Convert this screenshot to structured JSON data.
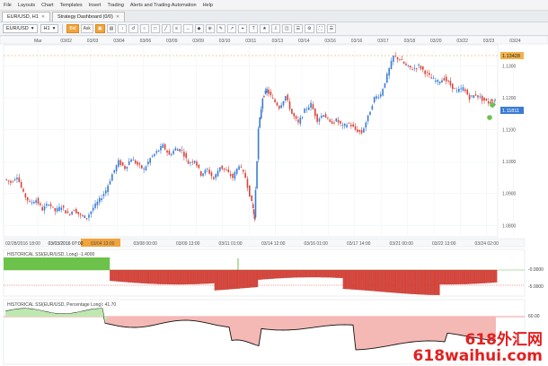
{
  "menu": [
    "File",
    "Layouts",
    "Chart",
    "Templates",
    "Insert",
    "Trading",
    "Alerts and Trading Automation",
    "Help"
  ],
  "tabs": [
    {
      "label": "EUR/USD, H1",
      "active": true
    },
    {
      "label": "Strategy Dashboard (0/0)",
      "active": false
    }
  ],
  "toolbar": {
    "symbol": "EUR/USD",
    "timeframe": "H1",
    "buttons": [
      "Bid",
      "Ask",
      "▣",
      "▤",
      "↕",
      "↺",
      "○",
      "□",
      "╱",
      "≡",
      "↔",
      "◆",
      "⊕",
      "✎",
      "↗",
      "⌖",
      "T",
      "★",
      "⇩",
      "◫",
      "☰",
      "⚙",
      "⛶",
      "☰"
    ]
  },
  "top_dates": [
    "Mar",
    "03/02",
    "03/03",
    "03/04",
    "03/06",
    "03/09",
    "03/09",
    "03/10",
    "03/11",
    "03/13",
    "03/14",
    "03/16",
    "03/16",
    "03/17",
    "03/18",
    "03/20",
    "03/22",
    "03/23",
    "03/24"
  ],
  "bottom_dates": [
    "02/28/2016 18:00",
    "03/03/2016 07:00",
    "03/04 13:00",
    "03/08 00:00",
    "03/09 13:00",
    "03/11 01:00",
    "03/14 12:00",
    "03/16 01:00",
    "03/17 14:00",
    "03/21 00:00",
    "03/22 13:00",
    "03/24 02:00"
  ],
  "selected_date": "03/03/2016 07:00",
  "price_axis": [
    "1.1300",
    "1.1200",
    "1.1100",
    "1.1000",
    "1.0900",
    "1.0800"
  ],
  "price_current_high": "1.13428",
  "price_current": "1.11811",
  "indicator1": {
    "label": "HISTORICAL SSI(EUR/USD, Long) -1.4000",
    "axis": [
      "-0.0000",
      "-5.0000"
    ]
  },
  "indicator2": {
    "label": "HISTORICAL SSI(EUR/USD, Percentage Long): 41.70",
    "axis": [
      "60.00"
    ]
  },
  "marker_label": "2.2",
  "watermark": {
    "line1": "618外汇网",
    "line2": "618waihui.com"
  },
  "chart_data": {
    "type": "line",
    "ylim": [
      1.077,
      1.136
    ],
    "price_path": [
      [
        0,
        1.0945
      ],
      [
        3,
        1.0935
      ],
      [
        6,
        1.0955
      ],
      [
        9,
        1.09
      ],
      [
        12,
        1.087
      ],
      [
        15,
        1.088
      ],
      [
        18,
        1.085
      ],
      [
        21,
        1.087
      ],
      [
        24,
        1.0845
      ],
      [
        27,
        1.086
      ],
      [
        30,
        1.0835
      ],
      [
        33,
        1.085
      ],
      [
        36,
        1.083
      ],
      [
        39,
        1.0825
      ],
      [
        42,
        1.0855
      ],
      [
        45,
        1.088
      ],
      [
        48,
        1.091
      ],
      [
        51,
        1.096
      ],
      [
        54,
        1.1
      ],
      [
        57,
        1.098
      ],
      [
        60,
        1.101
      ],
      [
        63,
        1.099
      ],
      [
        66,
        1.0975
      ],
      [
        69,
        1.101
      ],
      [
        72,
        1.103
      ],
      [
        75,
        1.105
      ],
      [
        78,
        1.102
      ],
      [
        81,
        1.104
      ],
      [
        84,
        1.1035
      ],
      [
        87,
        1.0995
      ],
      [
        90,
        1.1005
      ],
      [
        93,
        1.096
      ],
      [
        96,
        1.0975
      ],
      [
        99,
        1.0945
      ],
      [
        102,
        1.0985
      ],
      [
        105,
        1.097
      ],
      [
        108,
        1.095
      ],
      [
        111,
        1.099
      ],
      [
        114,
        1.095
      ],
      [
        117,
        1.087
      ],
      [
        118,
        1.082
      ],
      [
        120,
        1.11
      ],
      [
        122,
        1.12
      ],
      [
        124,
        1.1225
      ],
      [
        127,
        1.1195
      ],
      [
        130,
        1.117
      ],
      [
        133,
        1.1205
      ],
      [
        136,
        1.115
      ],
      [
        139,
        1.112
      ],
      [
        142,
        1.116
      ],
      [
        145,
        1.118
      ],
      [
        148,
        1.113
      ],
      [
        151,
        1.115
      ],
      [
        154,
        1.112
      ],
      [
        157,
        1.113
      ],
      [
        160,
        1.111
      ],
      [
        163,
        1.112
      ],
      [
        166,
        1.11
      ],
      [
        169,
        1.109
      ],
      [
        172,
        1.114
      ],
      [
        175,
        1.12
      ],
      [
        178,
        1.121
      ],
      [
        181,
        1.127
      ],
      [
        184,
        1.133
      ],
      [
        187,
        1.132
      ],
      [
        190,
        1.13
      ],
      [
        193,
        1.129
      ],
      [
        196,
        1.13
      ],
      [
        199,
        1.128
      ],
      [
        202,
        1.126
      ],
      [
        205,
        1.125
      ],
      [
        208,
        1.126
      ],
      [
        211,
        1.124
      ],
      [
        214,
        1.122
      ],
      [
        217,
        1.123
      ],
      [
        220,
        1.12
      ],
      [
        223,
        1.121
      ],
      [
        226,
        1.1195
      ],
      [
        229,
        1.1185
      ],
      [
        232,
        1.1181
      ]
    ],
    "ssi_long": {
      "positive_until": 0.215,
      "negative_values_range": [
        -1.2,
        -3.5
      ]
    },
    "ssi_percent_long": {
      "series_name": "Percentage Long",
      "last": 41.7
    }
  }
}
